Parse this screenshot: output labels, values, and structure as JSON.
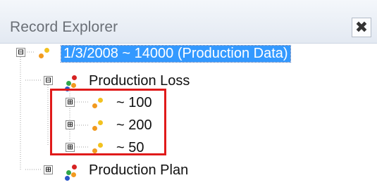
{
  "window": {
    "title": "Record Explorer",
    "close_glyph": "✖",
    "close_icon": "close-icon"
  },
  "tree": {
    "root": {
      "label": "1/3/2008 ~ 14000 (Production Data)",
      "expander": "⊟",
      "icon": "record-node-icon"
    },
    "children": [
      {
        "label": "Production Loss",
        "expander": "⊟",
        "icon": "family-node-icon",
        "children": [
          {
            "label": "~ 100",
            "expander": "⊞",
            "icon": "record-node-icon"
          },
          {
            "label": "~ 200",
            "expander": "⊞",
            "icon": "record-node-icon"
          },
          {
            "label": "~ 50",
            "expander": "⊞",
            "icon": "record-node-icon"
          }
        ]
      },
      {
        "label": "Production Plan",
        "expander": "⊞",
        "icon": "family-node-icon"
      }
    ]
  },
  "colors": {
    "selection": "#3399ff",
    "highlight_border": "#e01a1a",
    "record_dot_orange": "#f29a1f",
    "record_dot_yellow": "#f2c21f",
    "family_dot_red": "#d62222",
    "family_dot_green": "#2fa64a",
    "family_dot_blue": "#2a57c9",
    "family_dot_orange": "#f29a1f"
  }
}
